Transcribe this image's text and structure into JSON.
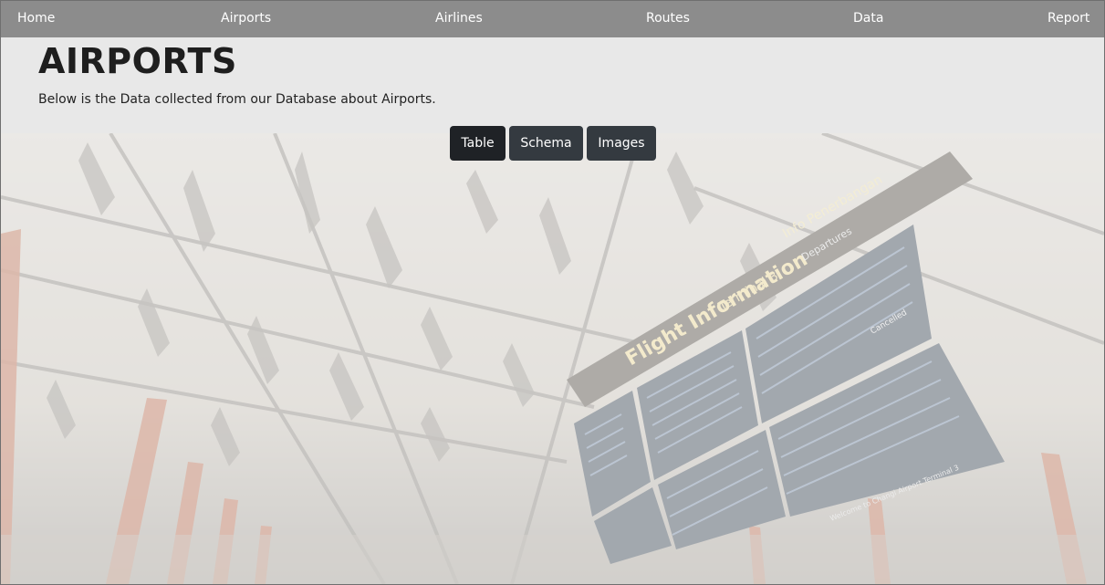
{
  "nav": {
    "home": "Home",
    "airports": "Airports",
    "airlines": "Airlines",
    "routes": "Routes",
    "data": "Data",
    "report": "Report"
  },
  "header": {
    "title": "AIRPORTS",
    "subtitle": "Below is the Data collected from our Database about Airports."
  },
  "view_buttons": {
    "table": "Table",
    "schema": "Schema",
    "images": "Images",
    "active": "Table"
  },
  "hero": {
    "board_heading": "Flight Information",
    "board_terminal": "Terminal 3",
    "board_subheading": "Info Penerbangan",
    "board_departures": "Departures",
    "board_status": "Cancelled",
    "board_footer": "Welcome to Changi Airport Terminal 3"
  },
  "colors": {
    "navbar": "#8c8c8c",
    "header_panel": "#e8e8e8",
    "button_active": "#1f2226",
    "button": "#343a40",
    "board": "#1c2a3a",
    "pillar": "#b5532f"
  }
}
